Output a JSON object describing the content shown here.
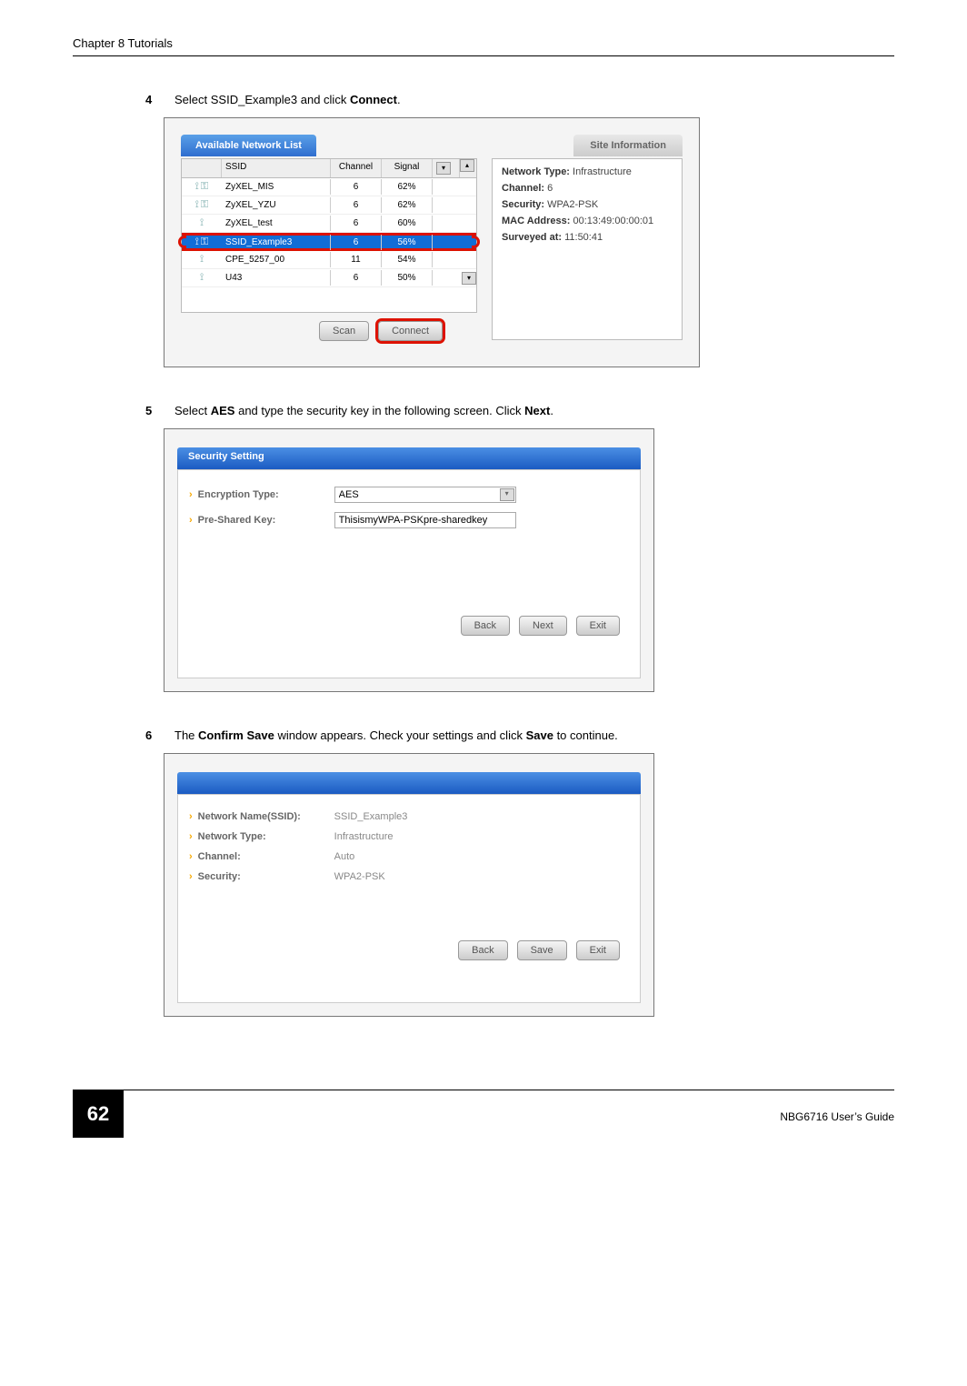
{
  "header": {
    "chapter": "Chapter 8 Tutorials"
  },
  "step4": {
    "num": "4",
    "pre": "Select SSID_Example3 and click ",
    "bold": "Connect",
    "post": "."
  },
  "fig1": {
    "tab_available": "Available Network List",
    "tab_siteinfo": "Site Information",
    "col_ssid": "SSID",
    "col_channel": "Channel",
    "col_signal": "Signal",
    "rows": [
      {
        "ssid": "ZyXEL_MIS",
        "ch": "6",
        "sig": "62%"
      },
      {
        "ssid": "ZyXEL_YZU",
        "ch": "6",
        "sig": "62%"
      },
      {
        "ssid": "ZyXEL_test",
        "ch": "6",
        "sig": "60%"
      },
      {
        "ssid": "SSID_Example3",
        "ch": "6",
        "sig": "56%"
      },
      {
        "ssid": "CPE_5257_00",
        "ch": "11",
        "sig": "54%"
      },
      {
        "ssid": "U43",
        "ch": "6",
        "sig": "50%"
      }
    ],
    "btn_scan": "Scan",
    "btn_connect": "Connect",
    "si_nettype_l": "Network Type:",
    "si_nettype_v": "Infrastructure",
    "si_channel_l": "Channel:",
    "si_channel_v": "6",
    "si_security_l": "Security:",
    "si_security_v": "WPA2-PSK",
    "si_mac_l": "MAC Address:",
    "si_mac_v": "00:13:49:00:00:01",
    "si_surveyed_l": "Surveyed at:",
    "si_surveyed_v": "11:50:41"
  },
  "step5": {
    "num": "5",
    "p1": "Select ",
    "b1": "AES",
    "p2": " and type the security key in the following screen. Click ",
    "b2": "Next",
    "p3": "."
  },
  "fig2": {
    "title": "Security Setting",
    "enc_label": "Encryption Type:",
    "enc_value": "AES",
    "psk_label": "Pre-Shared Key:",
    "psk_value": "ThisismyWPA-PSKpre-sharedkey",
    "btn_back": "Back",
    "btn_next": "Next",
    "btn_exit": "Exit"
  },
  "step6": {
    "num": "6",
    "p1": "The ",
    "b1": "Confirm Save",
    "p2": " window appears. Check your settings and click ",
    "b2": "Save",
    "p3": " to continue."
  },
  "fig3": {
    "nn_label": "Network Name(SSID):",
    "nn_value": "SSID_Example3",
    "nt_label": "Network Type:",
    "nt_value": "Infrastructure",
    "ch_label": "Channel:",
    "ch_value": "Auto",
    "sec_label": "Security:",
    "sec_value": "WPA2-PSK",
    "btn_back": "Back",
    "btn_save": "Save",
    "btn_exit": "Exit"
  },
  "footer": {
    "page": "62",
    "guide": "NBG6716 User’s Guide"
  }
}
